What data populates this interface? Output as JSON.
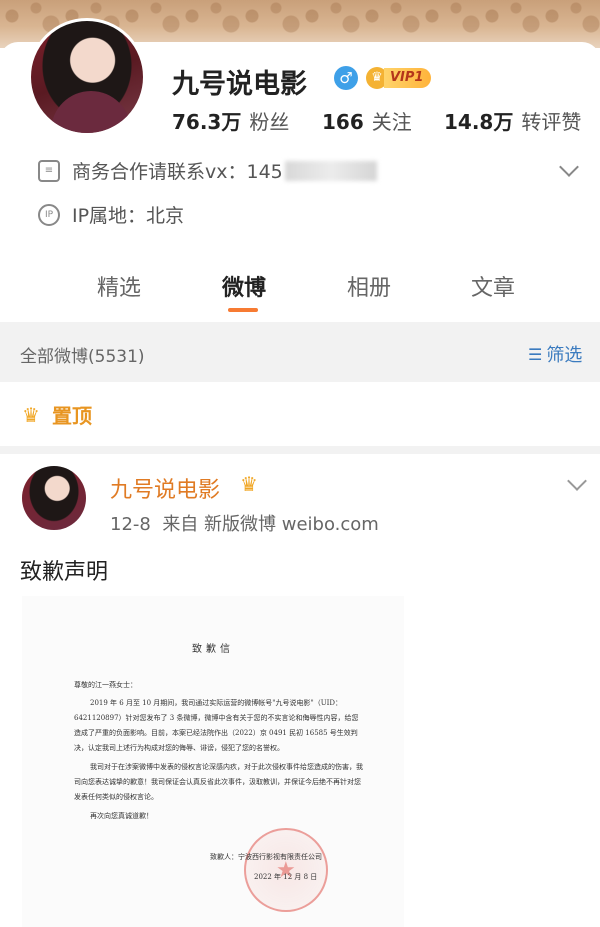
{
  "profile": {
    "name": "九号说电影",
    "gender_icon": "male-icon",
    "vip_label": "VIP1",
    "stats": {
      "fans_value": "76.3万",
      "fans_label": "粉丝",
      "follow_value": "166",
      "follow_label": "关注",
      "repost_value": "14.8万",
      "repost_label": "转评赞"
    },
    "business_contact": "商务合作请联系vx：145",
    "ip_location": "IP属地：北京"
  },
  "tabs": [
    {
      "label": "精选"
    },
    {
      "label": "微博"
    },
    {
      "label": "相册"
    },
    {
      "label": "文章"
    }
  ],
  "active_tab": "微博",
  "filter": {
    "count_label": "全部微博(5531)",
    "button_label": "筛选"
  },
  "pinned_label": "置顶",
  "post": {
    "author": "九号说电影",
    "date": "12-8",
    "source": "来自 新版微博 weibo.com",
    "text": "致歉声明",
    "letter": {
      "title": "致歉信",
      "greeting": "尊敬的江一燕女士：",
      "paragraph1": "2019 年 6 月至 10 月期间，我司通过实际运营的微博帐号\"九号说电影\"（UID：6421120897）针对您发布了 3 条微博，微博中含有关于您的不实言论和侮辱性内容，给您造成了严重的负面影响。目前，本案已经法院作出（2022）京 0491 民初 16585 号生效判决，认定我司上述行为构成对您的侮辱、诽谤，侵犯了您的名誉权。",
      "paragraph2": "我司对于在涉案微博中发表的侵权言论深感内疚，对于此次侵权事件给您造成的伤害，我司向您表达诚挚的歉意！我司保证会认真反省此次事件，汲取教训，并保证今后绝不再针对您发表任何类似的侵权言论。",
      "paragraph3": "再次向您真诚道歉！",
      "signer": "致歉人：宁波西行影视有限责任公司",
      "date": "2022 年 12 月 8 日"
    }
  },
  "colors": {
    "accent_orange": "#f77b33",
    "link_blue": "#3b7bbf",
    "pinned_gold": "#e89521"
  }
}
